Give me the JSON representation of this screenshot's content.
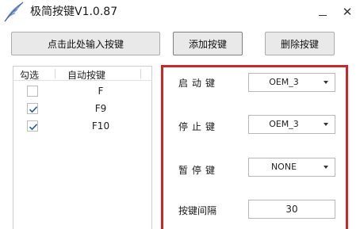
{
  "window": {
    "title": "极简按键V1.0.87",
    "minimize_glyph": "",
    "close_glyph": "✕"
  },
  "toolbar": {
    "input_label": "点击此处输入按键",
    "add_label": "添加按键",
    "delete_label": "删除按键"
  },
  "key_table": {
    "columns": [
      "勾选",
      "自动按键"
    ],
    "rows": [
      {
        "key": "F",
        "checked": false
      },
      {
        "key": "F9",
        "checked": true
      },
      {
        "key": "F10",
        "checked": true
      }
    ]
  },
  "settings": {
    "start_label": "启动键",
    "start_value": "OEM_3",
    "stop_label": "停止键",
    "stop_value": "OEM_3",
    "pause_label": "暂停键",
    "pause_value": "NONE",
    "interval_label": "按键间隔",
    "interval_value": "30"
  },
  "colors": {
    "highlight_border": "#cc2727",
    "checkmark": "#1f5fa8"
  }
}
